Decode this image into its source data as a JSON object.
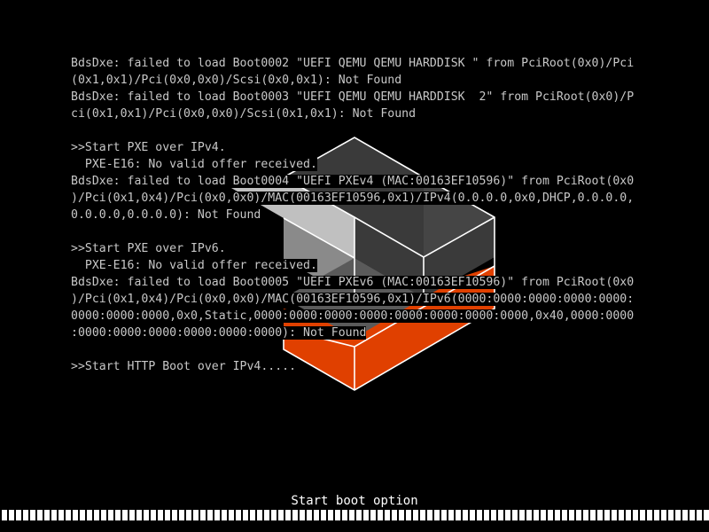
{
  "colors": {
    "background": "#000000",
    "console_text": "#c8c8c8",
    "logo_orange": "#e04000",
    "logo_dark": "#3a3a3a",
    "logo_light": "#c8c8c8",
    "logo_outline": "#ffffff",
    "progress_fill": "#ffffff"
  },
  "console": {
    "lines": [
      "BdsDxe: failed to load Boot0002 \"UEFI QEMU QEMU HARDDISK \" from PciRoot(0x0)/Pci",
      "(0x1,0x1)/Pci(0x0,0x0)/Scsi(0x0,0x1): Not Found",
      "BdsDxe: failed to load Boot0003 \"UEFI QEMU QEMU HARDDISK  2\" from PciRoot(0x0)/P",
      "ci(0x1,0x1)/Pci(0x0,0x0)/Scsi(0x1,0x1): Not Found",
      "",
      ">>Start PXE over IPv4.",
      "  PXE-E16: No valid offer received.",
      "BdsDxe: failed to load Boot0004 \"UEFI PXEv4 (MAC:00163EF10596)\" from PciRoot(0x0",
      ")/Pci(0x1,0x4)/Pci(0x0,0x0)/MAC(00163EF10596,0x1)/IPv4(0.0.0.0,0x0,DHCP,0.0.0.0,",
      "0.0.0.0,0.0.0.0): Not Found",
      "",
      ">>Start PXE over IPv6.",
      "  PXE-E16: No valid offer received.",
      "BdsDxe: failed to load Boot0005 \"UEFI PXEv6 (MAC:00163EF10596)\" from PciRoot(0x0",
      ")/Pci(0x1,0x4)/Pci(0x0,0x0)/MAC(00163EF10596,0x1)/IPv6(0000:0000:0000:0000:0000:",
      "0000:0000:0000,0x0,Static,0000:0000:0000:0000:0000:0000:0000:0000,0x40,0000:0000",
      ":0000:0000:0000:0000:0000:0000): Not Found",
      "",
      ">>Start HTTP Boot over IPv4....."
    ]
  },
  "footer": {
    "boot_label": "Start boot option",
    "progress_fraction": 1.0
  },
  "logo": {
    "icon": "lxd-logo-icon"
  }
}
